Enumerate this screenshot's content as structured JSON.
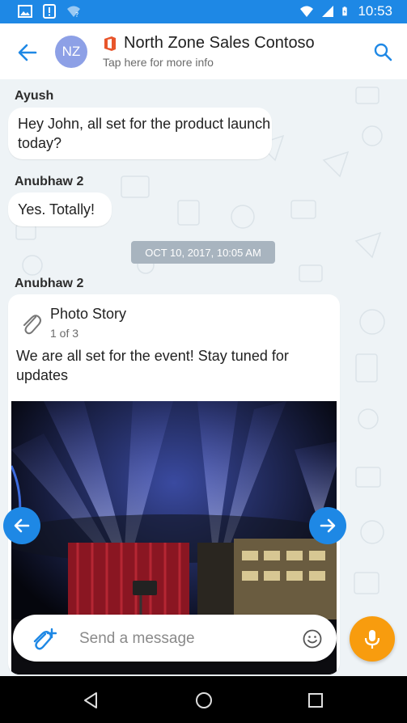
{
  "status_bar": {
    "time": "10:53",
    "icons": [
      "image-icon",
      "alert-icon",
      "wifi-question-icon",
      "wifi-icon",
      "signal-icon",
      "battery-charging-icon"
    ]
  },
  "header": {
    "avatar_initials": "NZ",
    "title": "North Zone Sales Contoso",
    "subtitle": "Tap here for more info",
    "icons": [
      "back-arrow-icon",
      "office-icon",
      "search-icon"
    ]
  },
  "messages": [
    {
      "sender": "Ayush",
      "text": "Hey John, all set for the product launch today?"
    },
    {
      "sender": "Anubhaw 2",
      "text": "Yes. Totally!"
    }
  ],
  "date_separator": "OCT 10, 2017, 10:05 AM",
  "card_message": {
    "sender": "Anubhaw 2",
    "card_title": "Photo Story",
    "card_count": "1 of 3",
    "card_text": "We are all set for the event! Stay tuned for updates",
    "icons": [
      "paperclip-icon",
      "prev-arrow-icon",
      "next-arrow-icon"
    ]
  },
  "composer": {
    "placeholder": "Send a message",
    "icons": [
      "attach-plus-icon",
      "emoji-icon",
      "microphone-icon"
    ]
  },
  "nav_bar": {
    "icons": [
      "back-triangle-icon",
      "home-circle-icon",
      "recents-square-icon"
    ]
  },
  "colors": {
    "accent": "#1e88e5",
    "mic": "#f89c0e",
    "avatar": "#8da0e6",
    "chat_bg": "#eef3f6",
    "office": "#e8552b"
  }
}
